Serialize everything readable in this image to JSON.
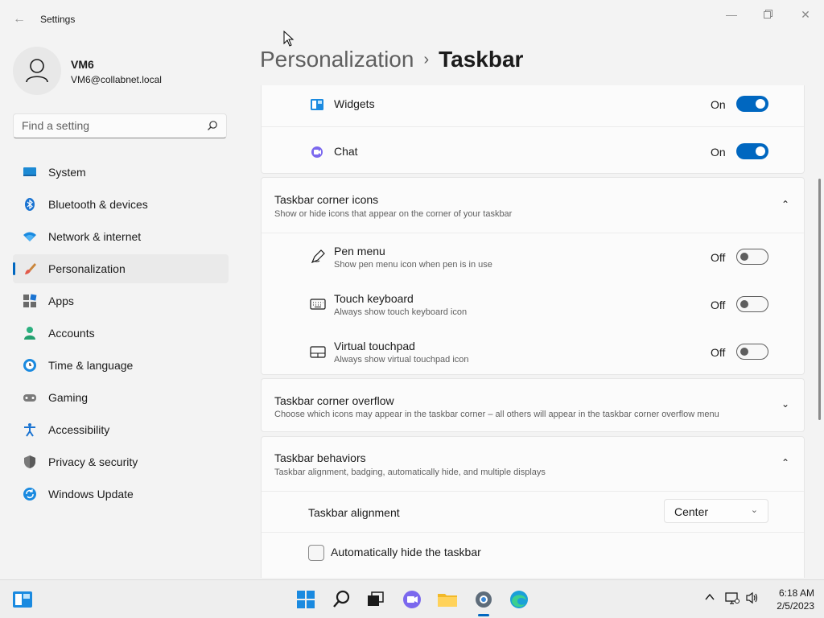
{
  "window": {
    "title": "Settings",
    "back_icon": "arrow-left-icon"
  },
  "profile": {
    "name": "VM6",
    "email": "VM6@collabnet.local"
  },
  "search": {
    "placeholder": "Find a setting"
  },
  "sidebar": {
    "items": [
      {
        "label": "System",
        "icon": "monitor-icon"
      },
      {
        "label": "Bluetooth & devices",
        "icon": "bluetooth-icon"
      },
      {
        "label": "Network & internet",
        "icon": "wifi-icon"
      },
      {
        "label": "Personalization",
        "icon": "paintbrush-icon",
        "selected": true
      },
      {
        "label": "Apps",
        "icon": "apps-icon"
      },
      {
        "label": "Accounts",
        "icon": "person-icon"
      },
      {
        "label": "Time & language",
        "icon": "clock-globe-icon"
      },
      {
        "label": "Gaming",
        "icon": "gamepad-icon"
      },
      {
        "label": "Accessibility",
        "icon": "accessibility-icon"
      },
      {
        "label": "Privacy & security",
        "icon": "shield-icon"
      },
      {
        "label": "Windows Update",
        "icon": "update-icon"
      }
    ]
  },
  "breadcrumb": {
    "parent": "Personalization",
    "separator": "›",
    "current": "Taskbar"
  },
  "taskbar_items": {
    "widgets": {
      "label": "Widgets",
      "state": "On"
    },
    "chat": {
      "label": "Chat",
      "state": "On"
    }
  },
  "corner_icons": {
    "title": "Taskbar corner icons",
    "subtitle": "Show or hide icons that appear on the corner of your taskbar",
    "items": [
      {
        "label": "Pen menu",
        "desc": "Show pen menu icon when pen is in use",
        "state": "Off"
      },
      {
        "label": "Touch keyboard",
        "desc": "Always show touch keyboard icon",
        "state": "Off"
      },
      {
        "label": "Virtual touchpad",
        "desc": "Always show virtual touchpad icon",
        "state": "Off"
      }
    ]
  },
  "corner_overflow": {
    "title": "Taskbar corner overflow",
    "subtitle": "Choose which icons may appear in the taskbar corner – all others will appear in the taskbar corner overflow menu"
  },
  "behaviors": {
    "title": "Taskbar behaviors",
    "subtitle": "Taskbar alignment, badging, automatically hide, and multiple displays",
    "alignment_label": "Taskbar alignment",
    "alignment_value": "Center",
    "autohide_label": "Automatically hide the taskbar",
    "autohide_checked": false
  },
  "system_tray": {
    "time": "6:18 AM",
    "date": "2/5/2023"
  },
  "colors": {
    "accent": "#0067c0"
  }
}
